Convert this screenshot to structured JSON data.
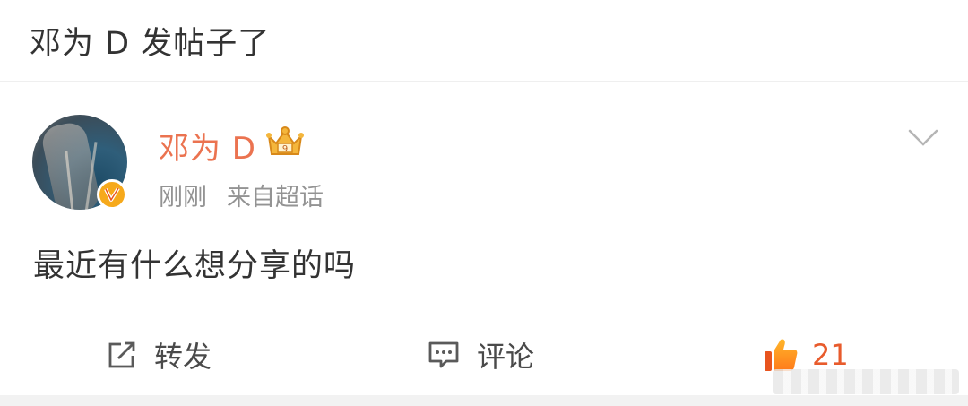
{
  "header": {
    "title": "邓为 D 发帖子了"
  },
  "post": {
    "username": "邓为 D",
    "time": "刚刚",
    "source": "来自超话",
    "text": "最近有什么想分享的吗"
  },
  "actions": {
    "repost_label": "转发",
    "comment_label": "评论",
    "like_count": "21"
  },
  "icons": {
    "verified": "verified-badge-icon",
    "crown": "crown-icon",
    "chevron": "chevron-down-icon",
    "repost": "repost-icon",
    "comment": "comment-icon",
    "like": "thumbs-up-icon"
  },
  "colors": {
    "username": "#eb7350",
    "like": "#e85b2c",
    "badge": "#f6a91b"
  }
}
